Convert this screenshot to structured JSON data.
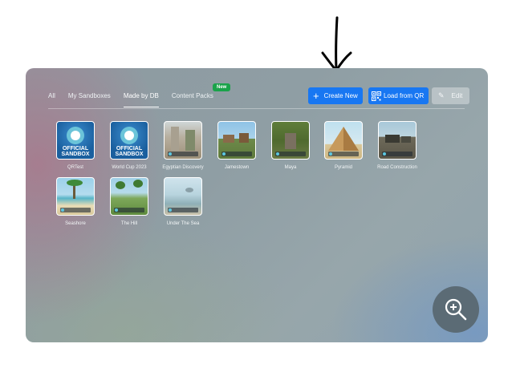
{
  "tabs": [
    {
      "label": "All",
      "active": false
    },
    {
      "label": "My Sandboxes",
      "active": false
    },
    {
      "label": "Made by DB",
      "active": true
    },
    {
      "label": "Content Packs",
      "active": false
    }
  ],
  "new_badge": "New",
  "buttons": {
    "create": "Create New",
    "qr": "Load from QR",
    "edit": "Edit"
  },
  "official_text": [
    "OFFICIAL",
    "SANDBOX"
  ],
  "items": [
    {
      "label": "QRTest",
      "thumb": "official"
    },
    {
      "label": "World Cup 2023",
      "thumb": "official"
    },
    {
      "label": "Egyptian Discovery",
      "thumb": "ruins"
    },
    {
      "label": "Jamestown",
      "thumb": "village"
    },
    {
      "label": "Maya",
      "thumb": "jungle"
    },
    {
      "label": "Pyramid",
      "thumb": "pyramid"
    },
    {
      "label": "Road Construction",
      "thumb": "construction"
    },
    {
      "label": "Seashore",
      "thumb": "seashore"
    },
    {
      "label": "The Hill",
      "thumb": "hill"
    },
    {
      "label": "Under The Sea",
      "thumb": "sea"
    }
  ],
  "colors": {
    "accent": "#1877f2",
    "new_badge": "#1aa34a"
  }
}
